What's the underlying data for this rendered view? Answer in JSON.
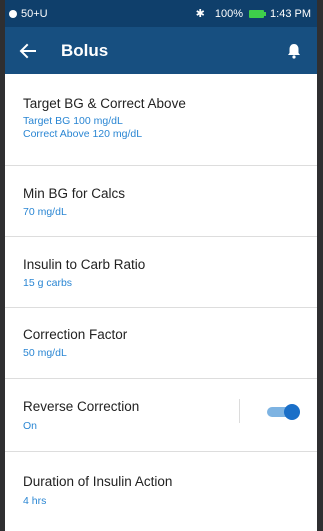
{
  "status_bar": {
    "network": "50+U",
    "battery": "100%",
    "time": "1:43 PM",
    "icons": {
      "signal": "signal-dot-icon",
      "bluetooth": "bluetooth-icon",
      "battery": "battery-icon"
    }
  },
  "app_bar": {
    "title": "Bolus",
    "back_icon": "arrow-left-icon",
    "bell_icon": "bell-icon"
  },
  "settings": [
    {
      "title": "Target BG & Correct Above",
      "values": [
        "Target BG 100 mg/dL",
        "Correct Above 120 mg/dL"
      ]
    },
    {
      "title": "Min BG for Calcs",
      "values": [
        "70 mg/dL"
      ]
    },
    {
      "title": "Insulin to Carb Ratio",
      "values": [
        "15 g carbs"
      ]
    },
    {
      "title": "Correction Factor",
      "values": [
        "50 mg/dL"
      ]
    },
    {
      "title": "Reverse Correction",
      "values": [
        "On"
      ],
      "toggle_on": true
    },
    {
      "title": "Duration of Insulin Action",
      "values": [
        "4 hrs"
      ]
    }
  ],
  "colors": {
    "status_bar": "#0f3f6b",
    "app_bar": "#174f80",
    "value_text": "#2a86d3",
    "toggle_knob": "#1a6fc8",
    "toggle_track": "#7db3e2"
  }
}
